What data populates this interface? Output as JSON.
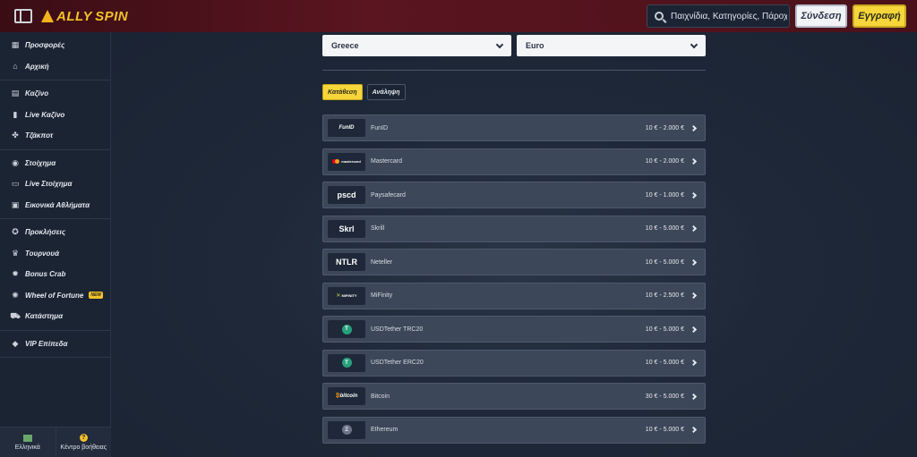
{
  "header": {
    "logo_text_a": "ALLY",
    "logo_text_b": "SPIN",
    "search_placeholder": "Παιχνίδια, Κατηγορίες, Πάροχοι",
    "login_label": "Σύνδεση",
    "register_label": "Εγγραφή"
  },
  "sidebar": {
    "groups": [
      [
        {
          "label": "Προσφορές",
          "icon": "gift-icon"
        },
        {
          "label": "Αρχική",
          "icon": "home-icon"
        }
      ],
      [
        {
          "label": "Καζίνο",
          "icon": "slot-icon"
        },
        {
          "label": "Live Καζίνο",
          "icon": "cards-icon"
        },
        {
          "label": "Τζάκποτ",
          "icon": "clover-icon"
        }
      ],
      [
        {
          "label": "Στοίχημα",
          "icon": "football-icon"
        },
        {
          "label": "Live Στοίχημα",
          "icon": "live-icon"
        },
        {
          "label": "Εικονικά Αθλήματα",
          "icon": "virtual-icon"
        }
      ],
      [
        {
          "label": "Προκλήσεις",
          "icon": "medal-icon"
        },
        {
          "label": "Τουρνουά",
          "icon": "trophy-icon"
        },
        {
          "label": "Bonus Crab",
          "icon": "crab-icon"
        },
        {
          "label": "Wheel of Fortune",
          "icon": "wheel-icon",
          "badge": "NEW"
        },
        {
          "label": "Κατάστημα",
          "icon": "cart-icon"
        }
      ],
      [
        {
          "label": "VIP Επίπεδα",
          "icon": "diamond-icon"
        }
      ]
    ],
    "language_label": "Ελληνικά",
    "help_label": "Κέντρο βοήθειας"
  },
  "filters": {
    "country": "Greece",
    "currency": "Euro"
  },
  "tabs": {
    "deposit": "Κατάθεση",
    "withdraw": "Ανάληψη"
  },
  "methods": [
    {
      "name": "FunID",
      "range": "10 € - 2.000 €",
      "logo": "FunID"
    },
    {
      "name": "Mastercard",
      "range": "10 € - 2.000 €",
      "logo": "mastercard"
    },
    {
      "name": "Paysafecard",
      "range": "10 € - 1.000 €",
      "logo": "pscd"
    },
    {
      "name": "Skrill",
      "range": "10 € - 5.000 €",
      "logo": "Skrl"
    },
    {
      "name": "Neteller",
      "range": "10 € - 5.000 €",
      "logo": "NTLR"
    },
    {
      "name": "MiFinity",
      "range": "10 € - 2.500 €",
      "logo": "MiFINITY"
    },
    {
      "name": "USDTether TRC20",
      "range": "10 € - 5.000 €",
      "logo": "T"
    },
    {
      "name": "USDTether ERC20",
      "range": "10 € - 5.000 €",
      "logo": "T"
    },
    {
      "name": "Bitcoin",
      "range": "30 € - 5.000 €",
      "logo": "bitcoin"
    },
    {
      "name": "Ethereum",
      "range": "10 € - 5.000 €",
      "logo": "Ξ"
    }
  ],
  "colors": {
    "accent": "#f6d63a",
    "header": "#4a111a",
    "panel": "#1b2433",
    "row": "#3c4759"
  }
}
